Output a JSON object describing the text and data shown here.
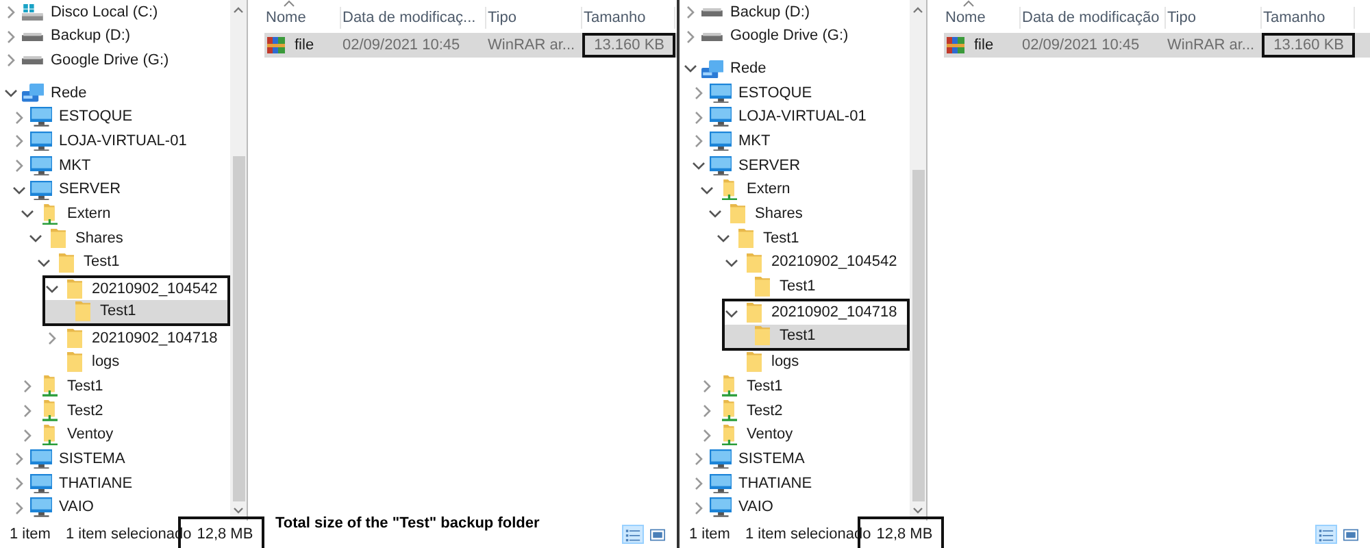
{
  "panes": [
    {
      "tree": [
        {
          "label": "Disco Local (C:)",
          "kind": "drive-system",
          "expanded": false,
          "selected": false
        },
        {
          "label": "Backup (D:)",
          "kind": "drive",
          "expanded": false,
          "selected": false
        },
        {
          "label": "Google Drive (G:)",
          "kind": "drive",
          "expanded": false,
          "selected": false
        },
        {
          "label": "Rede",
          "kind": "network",
          "expanded": true,
          "selected": false,
          "children": [
            {
              "label": "ESTOQUE",
              "kind": "computer",
              "expanded": false,
              "selected": false
            },
            {
              "label": "LOJA-VIRTUAL-01",
              "kind": "computer",
              "expanded": false,
              "selected": false
            },
            {
              "label": "MKT",
              "kind": "computer",
              "expanded": false,
              "selected": false
            },
            {
              "label": "SERVER",
              "kind": "computer",
              "expanded": true,
              "selected": false,
              "children": [
                {
                  "label": "Extern",
                  "kind": "share",
                  "expanded": true,
                  "selected": false,
                  "children": [
                    {
                      "label": "Shares",
                      "kind": "folder",
                      "expanded": true,
                      "selected": false,
                      "children": [
                        {
                          "label": "Test1",
                          "kind": "folder",
                          "expanded": true,
                          "selected": false,
                          "children": [
                            {
                              "label": "20210902_104542",
                              "kind": "folder",
                              "expanded": true,
                              "selected": false,
                              "annotated": true,
                              "children": [
                                {
                                  "label": "Test1",
                                  "kind": "folder",
                                  "selected": true
                                }
                              ]
                            },
                            {
                              "label": "20210902_104718",
                              "kind": "folder",
                              "expanded": false,
                              "selected": false
                            },
                            {
                              "label": "logs",
                              "kind": "folder",
                              "selected": false
                            }
                          ]
                        }
                      ]
                    }
                  ]
                },
                {
                  "label": "Test1",
                  "kind": "share",
                  "expanded": false,
                  "selected": false
                },
                {
                  "label": "Test2",
                  "kind": "share",
                  "expanded": false,
                  "selected": false
                },
                {
                  "label": "Ventoy",
                  "kind": "share",
                  "expanded": false,
                  "selected": false
                }
              ]
            },
            {
              "label": "SISTEMA",
              "kind": "computer",
              "expanded": false,
              "selected": false
            },
            {
              "label": "THATIANE",
              "kind": "computer",
              "expanded": false,
              "selected": false
            },
            {
              "label": "VAIO",
              "kind": "computer",
              "expanded": false,
              "selected": false
            }
          ]
        }
      ],
      "file_list": {
        "columns": [
          {
            "label": "Nome",
            "sorted": true
          },
          {
            "label": "Data de modificaç...",
            "sorted": false
          },
          {
            "label": "Tipo",
            "sorted": false
          },
          {
            "label": "Tamanho",
            "sorted": false
          }
        ],
        "rows": [
          {
            "name": "file",
            "date": "02/09/2021 10:45",
            "type": "WinRAR ar...",
            "size": "13.160 KB",
            "selected": true,
            "size_annotated": true
          }
        ]
      },
      "caption": "Total size of the \"Test\" backup folder",
      "status_bar": {
        "item_count": "1 item",
        "selection": "1 item selecionado",
        "size": "12,8 MB",
        "size_annotated": true,
        "views": [
          {
            "kind": "details",
            "selected": true
          },
          {
            "kind": "preview",
            "selected": false
          }
        ]
      }
    },
    {
      "tree": [
        {
          "label": "Backup (D:)",
          "kind": "drive",
          "expanded": false,
          "selected": false
        },
        {
          "label": "Google Drive (G:)",
          "kind": "drive",
          "expanded": false,
          "selected": false
        },
        {
          "label": "Rede",
          "kind": "network",
          "expanded": true,
          "selected": false,
          "children": [
            {
              "label": "ESTOQUE",
              "kind": "computer",
              "expanded": false,
              "selected": false
            },
            {
              "label": "LOJA-VIRTUAL-01",
              "kind": "computer",
              "expanded": false,
              "selected": false
            },
            {
              "label": "MKT",
              "kind": "computer",
              "expanded": false,
              "selected": false
            },
            {
              "label": "SERVER",
              "kind": "computer",
              "expanded": true,
              "selected": false,
              "children": [
                {
                  "label": "Extern",
                  "kind": "share",
                  "expanded": true,
                  "selected": false,
                  "children": [
                    {
                      "label": "Shares",
                      "kind": "folder",
                      "expanded": true,
                      "selected": false,
                      "children": [
                        {
                          "label": "Test1",
                          "kind": "folder",
                          "expanded": true,
                          "selected": false,
                          "children": [
                            {
                              "label": "20210902_104542",
                              "kind": "folder",
                              "expanded": true,
                              "selected": false,
                              "children": [
                                {
                                  "label": "Test1",
                                  "kind": "folder",
                                  "selected": false
                                }
                              ]
                            },
                            {
                              "label": "20210902_104718",
                              "kind": "folder",
                              "expanded": true,
                              "selected": false,
                              "annotated": true,
                              "children": [
                                {
                                  "label": "Test1",
                                  "kind": "folder",
                                  "selected": true
                                }
                              ]
                            },
                            {
                              "label": "logs",
                              "kind": "folder",
                              "selected": false
                            }
                          ]
                        }
                      ]
                    }
                  ]
                },
                {
                  "label": "Test1",
                  "kind": "share",
                  "expanded": false,
                  "selected": false
                },
                {
                  "label": "Test2",
                  "kind": "share",
                  "expanded": false,
                  "selected": false
                },
                {
                  "label": "Ventoy",
                  "kind": "share",
                  "expanded": false,
                  "selected": false
                }
              ]
            },
            {
              "label": "SISTEMA",
              "kind": "computer",
              "expanded": false,
              "selected": false
            },
            {
              "label": "THATIANE",
              "kind": "computer",
              "expanded": false,
              "selected": false
            },
            {
              "label": "VAIO",
              "kind": "computer",
              "expanded": false,
              "selected": false
            }
          ]
        }
      ],
      "file_list": {
        "columns": [
          {
            "label": "Nome",
            "sorted": true
          },
          {
            "label": "Data de modificação",
            "sorted": false
          },
          {
            "label": "Tipo",
            "sorted": false
          },
          {
            "label": "Tamanho",
            "sorted": false
          }
        ],
        "rows": [
          {
            "name": "file",
            "date": "02/09/2021 10:45",
            "type": "WinRAR ar...",
            "size": "13.160 KB",
            "selected": true,
            "size_annotated": true
          }
        ]
      },
      "status_bar": {
        "item_count": "1 item",
        "selection": "1 item selecionado",
        "size": "12,8 MB",
        "size_annotated": true,
        "views": [
          {
            "kind": "details",
            "selected": true
          },
          {
            "kind": "preview",
            "selected": false
          }
        ]
      }
    }
  ]
}
